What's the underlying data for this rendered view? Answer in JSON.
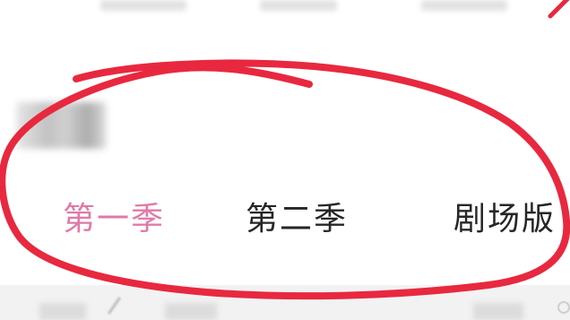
{
  "tabs": [
    {
      "label": "第一季",
      "active": true
    },
    {
      "label": "第二季",
      "active": false
    },
    {
      "label": "剧场版",
      "active": false
    }
  ],
  "colors": {
    "active_tab": "#e07aa6",
    "inactive_tab": "#262626",
    "annotation": "#e8283f",
    "background": "#ffffff",
    "bottom_strip": "#f2f2f2"
  }
}
